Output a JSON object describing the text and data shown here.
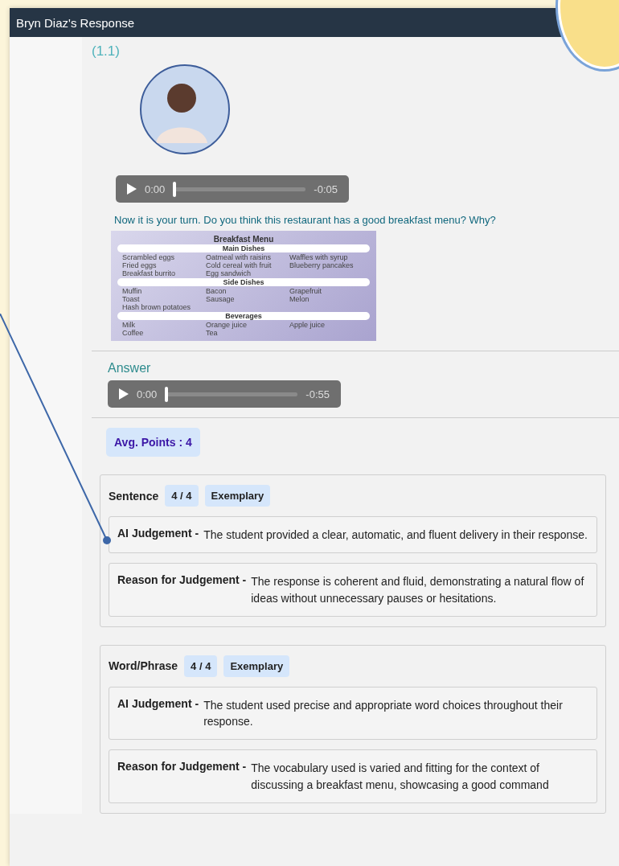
{
  "window": {
    "title": "Bryn Diaz's Response"
  },
  "question": {
    "number": "(1.1)",
    "audio": {
      "current": "0:00",
      "remaining": "-0:05",
      "level": 0
    },
    "text": "Now it is your turn. Do you think this restaurant has a good breakfast menu? Why?",
    "menu_image": {
      "title": "Breakfast Menu",
      "sections": [
        {
          "heading": "Main Dishes",
          "items": [
            "Scrambled eggs",
            "Oatmeal with raisins",
            "Waffles with syrup",
            "Fried eggs",
            "Cold cereal with fruit",
            "Blueberry pancakes",
            "Breakfast burrito",
            "Egg sandwich"
          ]
        },
        {
          "heading": "Side Dishes",
          "items": [
            "Muffin",
            "Bacon",
            "Grapefruit",
            "Toast",
            "Sausage",
            "Melon",
            "Hash brown potatoes"
          ]
        },
        {
          "heading": "Beverages",
          "items": [
            "Milk",
            "Orange juice",
            "Apple juice",
            "Coffee",
            "Tea"
          ]
        }
      ]
    }
  },
  "answer": {
    "label": "Answer",
    "audio": {
      "current": "0:00",
      "remaining": "-0:55",
      "level": 0
    }
  },
  "avg_points": "Avg. Points : 4",
  "criteria": [
    {
      "name": "Sentence",
      "score": "4 / 4",
      "rating": "Exemplary",
      "judgements": [
        {
          "label": "AI Judgement -",
          "text": "The student provided a clear, automatic, and fluent delivery in their response."
        },
        {
          "label": "Reason for Judgement -",
          "text": "The response is coherent and fluid, demonstrating a natural flow of ideas without unnecessary pauses or hesitations."
        }
      ]
    },
    {
      "name": "Word/Phrase",
      "score": "4 / 4",
      "rating": "Exemplary",
      "judgements": [
        {
          "label": "AI Judgement -",
          "text": "The student used precise and appropriate word choices throughout their response."
        },
        {
          "label": "Reason for Judgement -",
          "text": "The vocabulary used is varied and fitting for the context of discussing a breakfast menu, showcasing a good command"
        }
      ]
    }
  ]
}
